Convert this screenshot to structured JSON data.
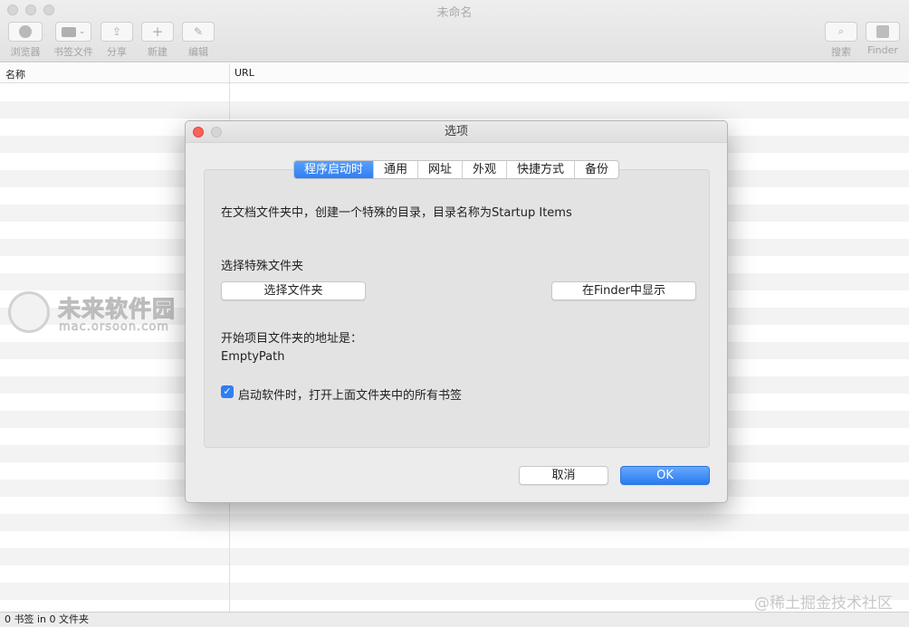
{
  "window": {
    "title": "未命名"
  },
  "toolbar": [
    {
      "label": "浏览器",
      "icon": "browser-icon"
    },
    {
      "label": "书签文件",
      "icon": "folder-icon"
    },
    {
      "label": "分享",
      "icon": "share-icon"
    },
    {
      "label": "新建",
      "icon": "plus-icon"
    },
    {
      "label": "编辑",
      "icon": "edit-icon"
    },
    {
      "label": "搜索",
      "icon": "search-icon"
    },
    {
      "label": "Finder",
      "icon": "finder-icon"
    }
  ],
  "columns": {
    "name": "名称",
    "url": "URL"
  },
  "status": "0 书签 in 0 文件夹",
  "watermark": {
    "brand": "未来软件园",
    "url": "mac.orsoon.com",
    "site": "@稀土掘金技术社区"
  },
  "dialog": {
    "title": "选项",
    "tabs": [
      "程序启动时",
      "通用",
      "网址",
      "外观",
      "快捷方式",
      "备份"
    ],
    "active_tab": 0,
    "description": "在文档文件夹中，创建一个特殊的目录，目录名称为Startup Items",
    "choose_label": "选择特殊文件夹",
    "choose_button": "选择文件夹",
    "show_in_finder_button": "在Finder中显示",
    "path_label": "开始项目文件夹的地址是：",
    "path_value": "EmptyPath",
    "open_all_checkbox": "启动软件时，打开上面文件夹中的所有书签",
    "open_all_checked": true,
    "cancel_button": "取消",
    "ok_button": "OK"
  },
  "colors": {
    "accent": "#2f7ef3",
    "close": "#fc605b"
  }
}
